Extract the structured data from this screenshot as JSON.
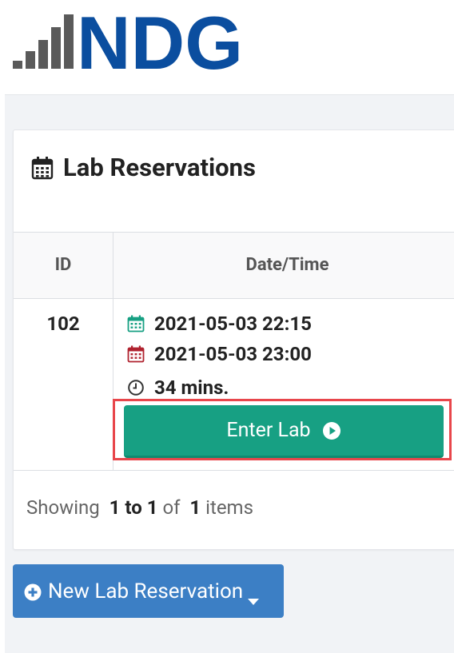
{
  "logo": {
    "text": "NDG"
  },
  "card": {
    "title": "Lab Reservations"
  },
  "table": {
    "headers": {
      "id": "ID",
      "datetime": "Date/Time"
    },
    "rows": [
      {
        "id": "102",
        "start": "2021-05-03 22:15",
        "end": "2021-05-03 23:00",
        "duration": "34 mins."
      }
    ]
  },
  "actions": {
    "enter_lab": "Enter Lab",
    "new_reservation": "New Lab Reservation"
  },
  "pager": {
    "showing": "Showing",
    "range": "1 to 1",
    "of": "of",
    "total": "1",
    "items": "items"
  },
  "colors": {
    "brand": "#0b4e9f",
    "enter_button": "#17a083",
    "new_button": "#3c7fc5",
    "start_icon": "#17a083",
    "end_icon": "#b0222f",
    "highlight": "#e8464b"
  },
  "icons": {
    "title": "calendar-icon",
    "start": "calendar-start-icon",
    "end": "calendar-end-icon",
    "duration": "clock-icon",
    "enter": "play-circle-icon",
    "new": "plus-circle-icon",
    "dropdown": "caret-down-icon"
  }
}
